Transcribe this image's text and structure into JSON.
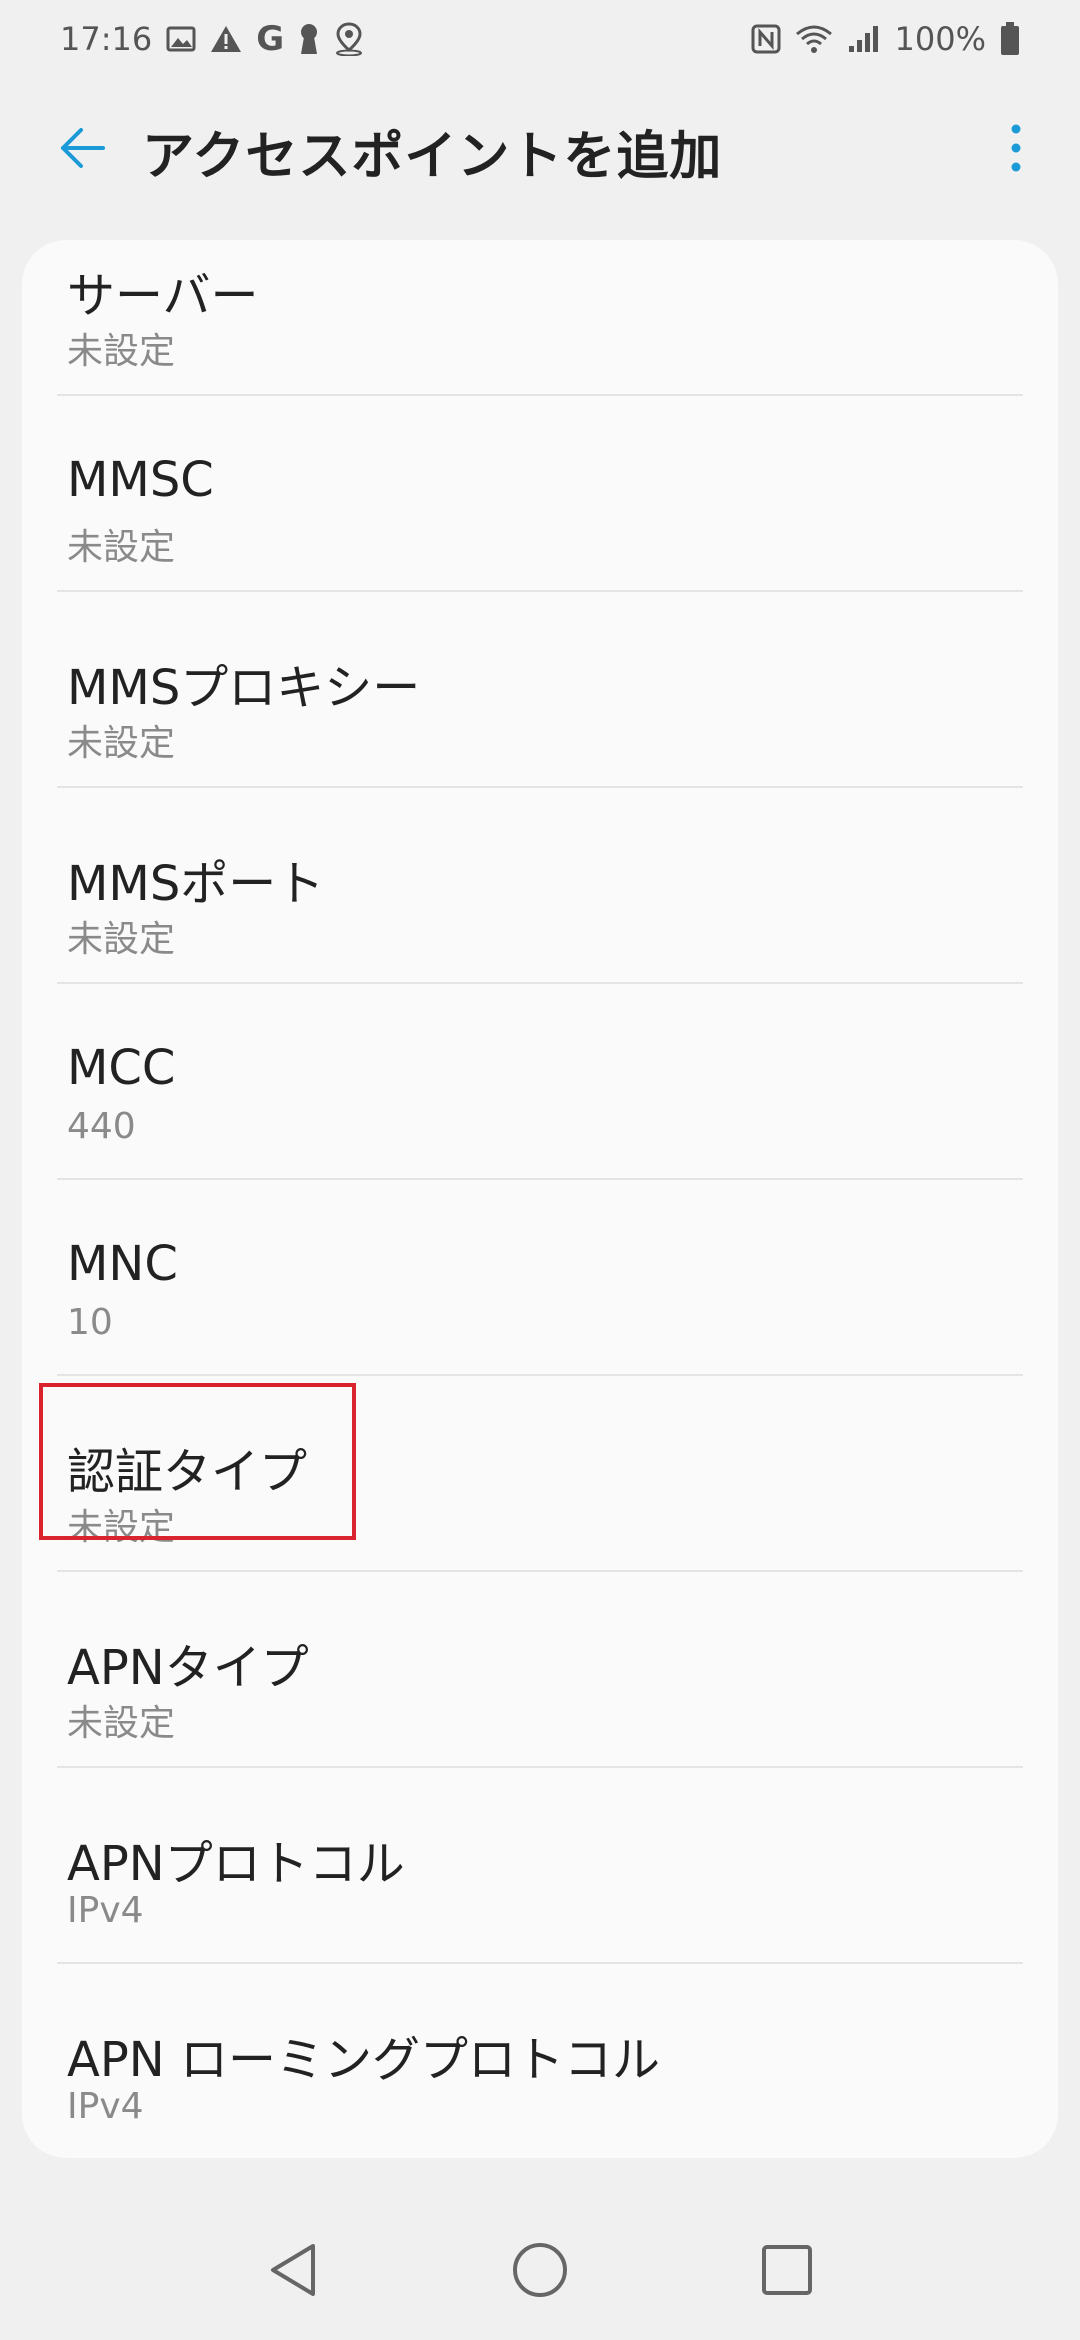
{
  "status_bar": {
    "time": "17:16",
    "battery_percent": "100%",
    "left_icons": [
      "image-icon",
      "alert-icon",
      "google-icon",
      "keyhole-icon",
      "location-pin-icon"
    ],
    "right_icons": [
      "nfc-icon",
      "wifi-icon",
      "signal-icon",
      "battery-icon"
    ]
  },
  "app_bar": {
    "title": "アクセスポイントを追加",
    "back_icon": "arrow-left-icon",
    "more_icon": "more-vert-icon",
    "accent_color": "#1a9bd7"
  },
  "settings": {
    "items": [
      {
        "title": "サーバー",
        "value": "未設定"
      },
      {
        "title": "MMSC",
        "value": "未設定"
      },
      {
        "title": "MMSプロキシー",
        "value": "未設定"
      },
      {
        "title": "MMSポート",
        "value": "未設定"
      },
      {
        "title": "MCC",
        "value": "440"
      },
      {
        "title": "MNC",
        "value": "10"
      },
      {
        "title": "認証タイプ",
        "value": "未設定"
      },
      {
        "title": "APNタイプ",
        "value": "未設定"
      },
      {
        "title": "APNプロトコル",
        "value": "IPv4"
      },
      {
        "title": "APN ローミングプロトコル",
        "value": "IPv4"
      }
    ]
  },
  "highlight": {
    "color": "#d9232d",
    "target": "認証タイプ"
  },
  "nav_bar": {
    "icons": [
      "back-triangle-icon",
      "home-circle-icon",
      "recents-square-icon"
    ]
  }
}
